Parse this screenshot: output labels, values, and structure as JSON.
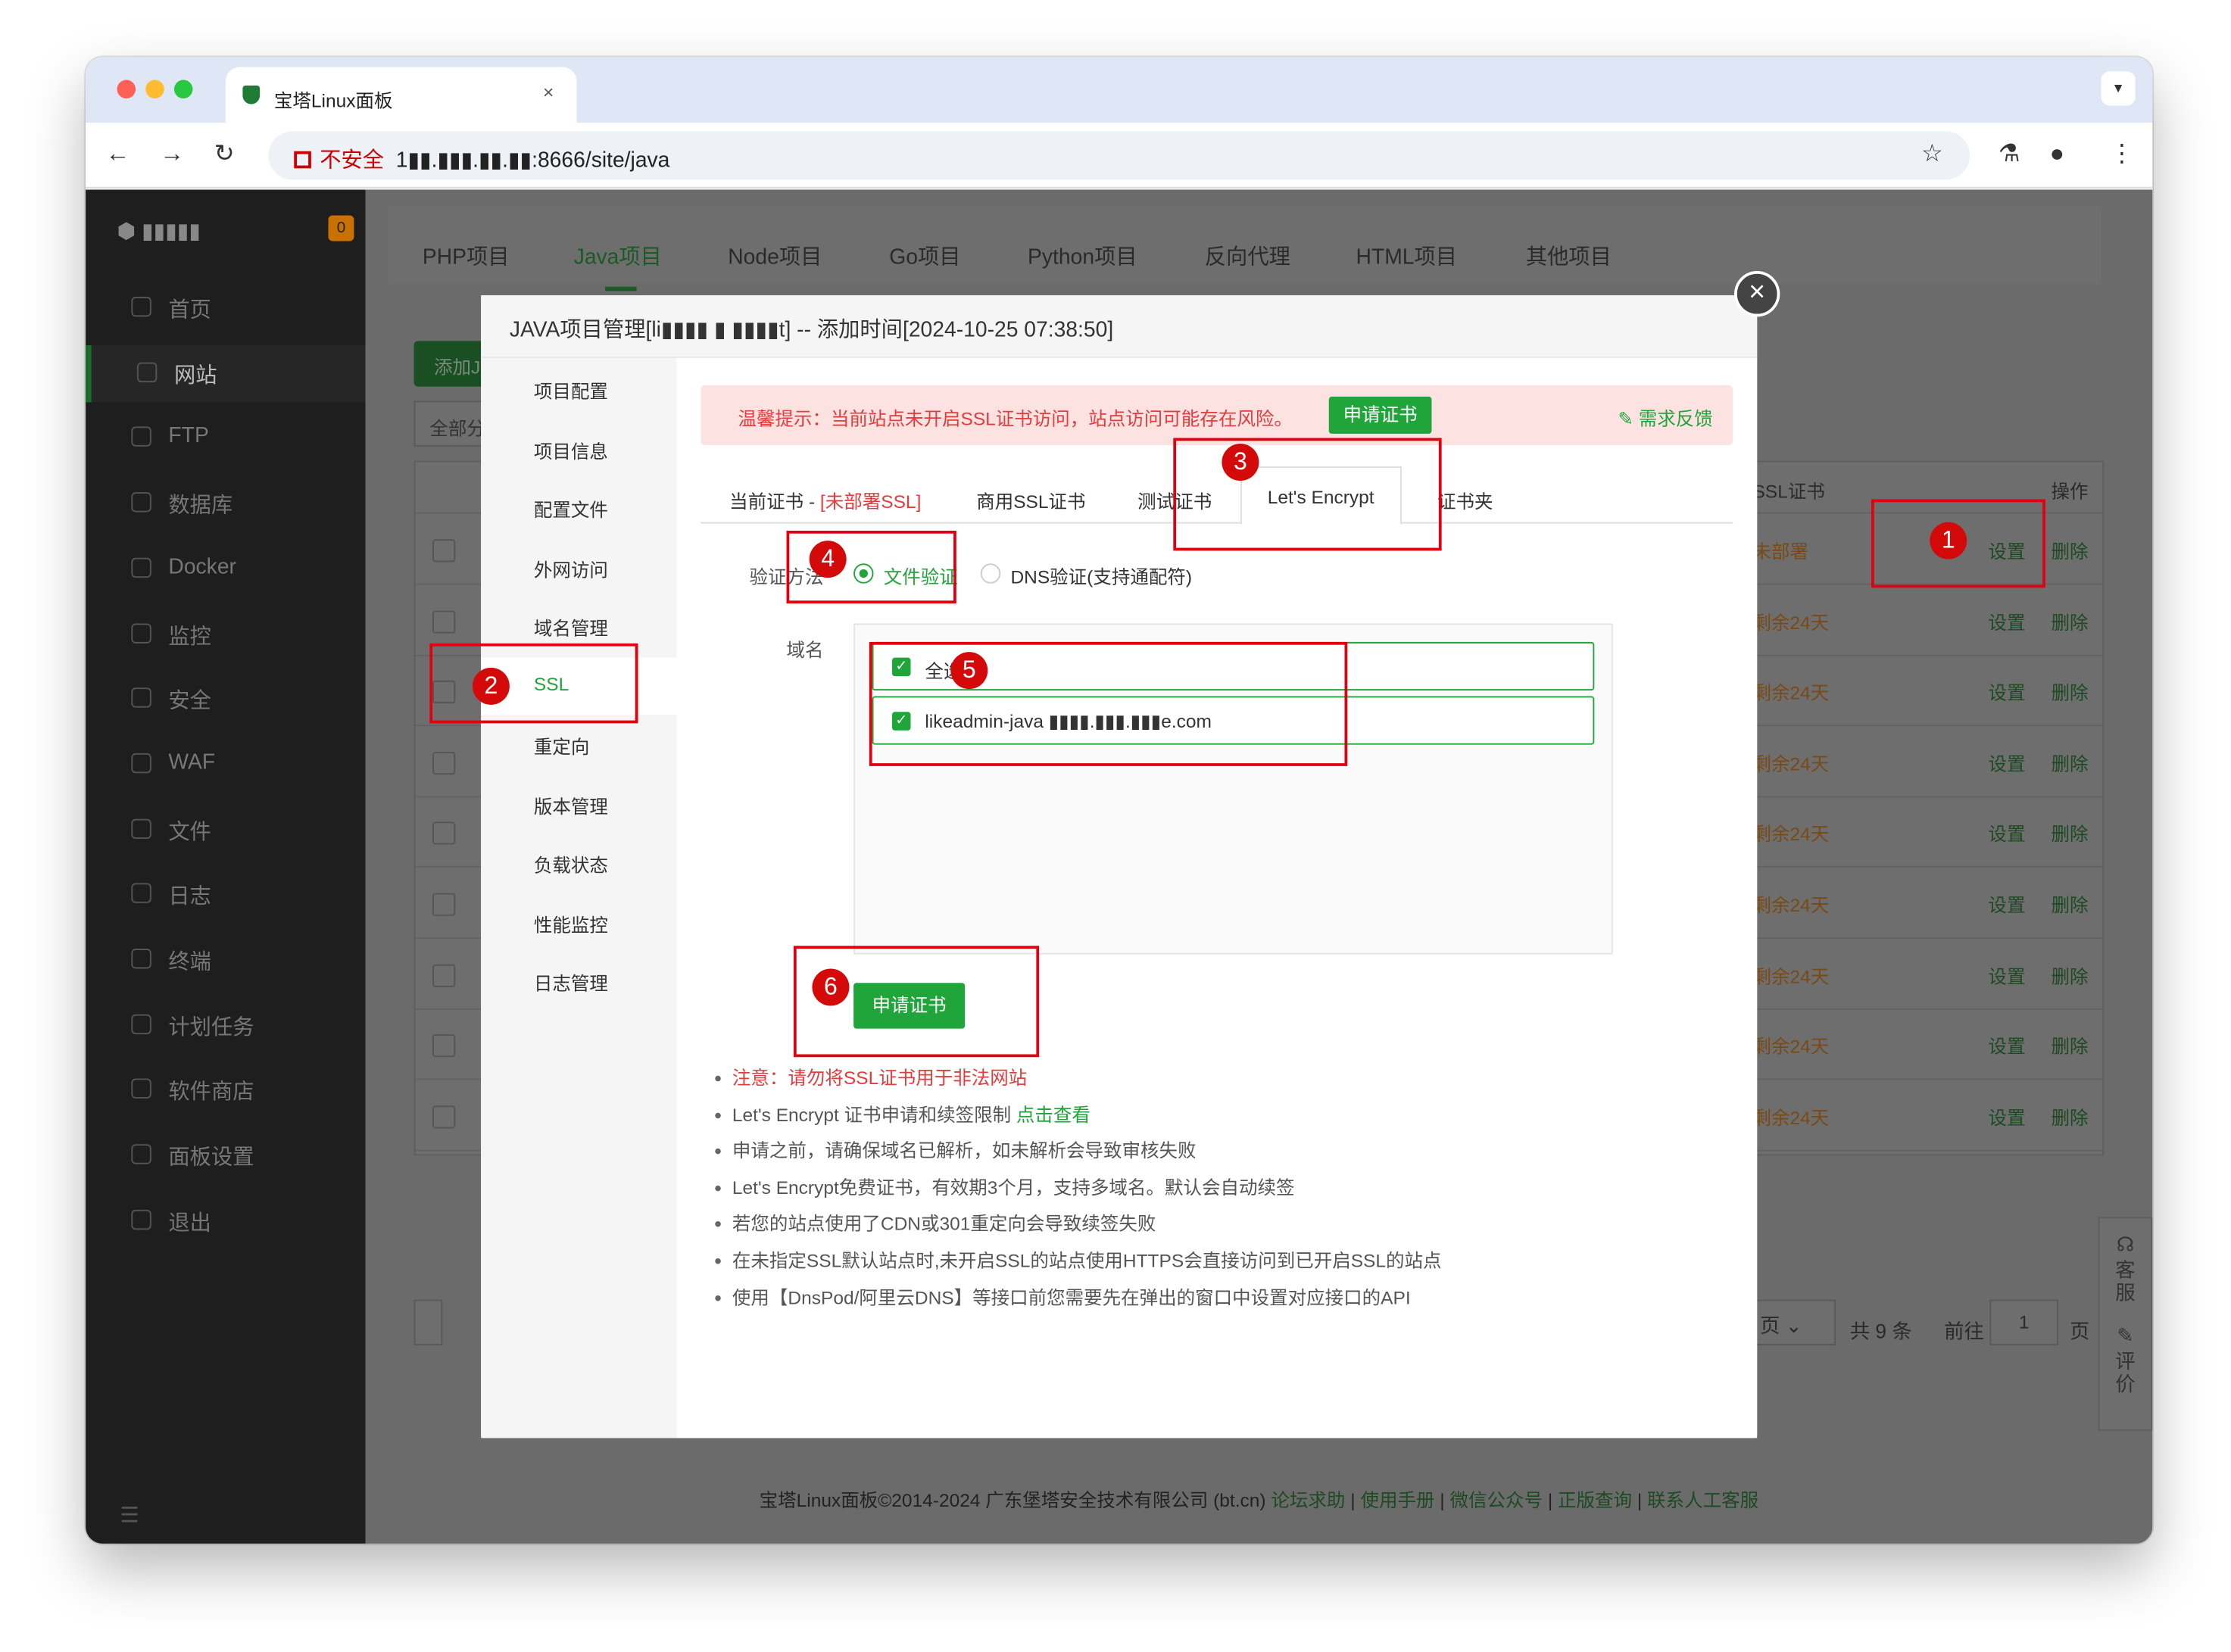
{
  "browser": {
    "tab_title": "宝塔Linux面板",
    "url_prefix": "不安全",
    "url_host_masked": "1▮▮.▮▮▮.▮▮.▮▮",
    "url_path": ":8666/site/java"
  },
  "sidebar": {
    "logo_text": "▮▮▮▮▮",
    "badge": "0",
    "items": [
      {
        "label": "首页"
      },
      {
        "label": "网站"
      },
      {
        "label": "FTP"
      },
      {
        "label": "数据库"
      },
      {
        "label": "Docker"
      },
      {
        "label": "监控"
      },
      {
        "label": "安全"
      },
      {
        "label": "WAF"
      },
      {
        "label": "文件"
      },
      {
        "label": "日志"
      },
      {
        "label": "终端"
      },
      {
        "label": "计划任务"
      },
      {
        "label": "软件商店"
      },
      {
        "label": "面板设置"
      },
      {
        "label": "退出"
      }
    ]
  },
  "project_tabs": [
    "PHP项目",
    "Java项目",
    "Node项目",
    "Go项目",
    "Python项目",
    "反向代理",
    "HTML项目",
    "其他项目"
  ],
  "background": {
    "add_button": "添加J",
    "filter": "全部分",
    "col_ssl": "SSL证书",
    "col_ops": "操作",
    "rows": [
      {
        "ssl": "未部署",
        "set": "设置",
        "del": "删除"
      },
      {
        "ssl": "剩余24天",
        "set": "设置",
        "del": "删除"
      },
      {
        "ssl": "剩余24天",
        "set": "设置",
        "del": "删除"
      },
      {
        "ssl": "剩余24天",
        "set": "设置",
        "del": "删除"
      },
      {
        "ssl": "剩余24天",
        "set": "设置",
        "del": "删除"
      },
      {
        "ssl": "剩余24天",
        "set": "设置",
        "del": "删除"
      },
      {
        "ssl": "剩余24天",
        "set": "设置",
        "del": "删除"
      },
      {
        "ssl": "剩余24天",
        "set": "设置",
        "del": "删除"
      },
      {
        "ssl": "剩余24天",
        "set": "设置",
        "del": "删除"
      }
    ],
    "pager": {
      "per_page": "页",
      "total": "共 9 条",
      "goto": "前往",
      "page": "1",
      "page_suffix": "页"
    },
    "float_service": "客服",
    "float_review": "评价"
  },
  "footer": {
    "copyright": "宝塔Linux面板©2014-2024 广东堡塔安全技术有限公司 (bt.cn)",
    "links": [
      "论坛求助",
      "使用手册",
      "微信公众号",
      "正版查询",
      "联系人工客服"
    ]
  },
  "modal": {
    "title": "JAVA项目管理[li▮▮▮▮ ▮ ▮▮▮▮t] -- 添加时间[2024-10-25 07:38:50]",
    "menu": [
      "项目配置",
      "项目信息",
      "配置文件",
      "外网访问",
      "域名管理",
      "SSL",
      "重定向",
      "版本管理",
      "负载状态",
      "性能监控",
      "日志管理"
    ],
    "alert": "温馨提示：当前站点未开启SSL证书访问，站点访问可能存在风险。",
    "alert_button": "申请证书",
    "feedback": "需求反馈",
    "ssl_tabs": {
      "current_prefix": "当前证书 - ",
      "current_status": "[未部署SSL]",
      "commercial": "商用SSL证书",
      "test": "测试证书",
      "letsencrypt": "Let's Encrypt",
      "folder": "证书夹"
    },
    "verify_label": "验证方法",
    "verify_file": "文件验证",
    "verify_dns": "DNS验证(支持通配符)",
    "domain_label": "域名",
    "select_all": "全选",
    "domain_item": "likeadmin-java ▮▮▮▮.▮▮▮.▮▮▮e.com",
    "apply_button": "申请证书",
    "notes_warning": "注意：请勿将SSL证书用于非法网站",
    "notes_limit": "Let's Encrypt 证书申请和续签限制 ",
    "notes_limit_link": "点击查看",
    "notes": [
      "申请之前，请确保域名已解析，如未解析会导致审核失败",
      "Let's Encrypt免费证书，有效期3个月，支持多域名。默认会自动续签",
      "若您的站点使用了CDN或301重定向会导致续签失败",
      "在未指定SSL默认站点时,未开启SSL的站点使用HTTPS会直接访问到已开启SSL的站点",
      "使用【DnsPod/阿里云DNS】等接口前您需要先在弹出的窗口中设置对应接口的API"
    ]
  },
  "annotations": [
    "1",
    "2",
    "3",
    "4",
    "5",
    "6"
  ],
  "colors": {
    "accent": "#20a53a",
    "annotation_red": "#e00010",
    "warning_red": "#e43c3c"
  }
}
